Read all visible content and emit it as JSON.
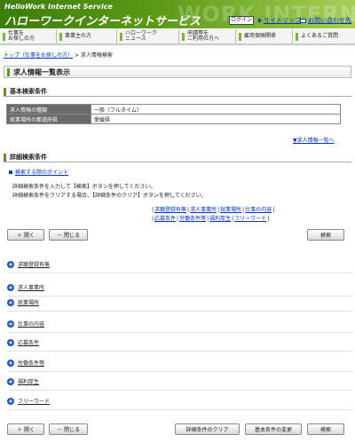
{
  "header": {
    "brand_en": "HelloWork Internet Service",
    "brand_jp": "ハローワークインターネットサービス",
    "watermark": "WORK INTERNE",
    "login": "ログイン",
    "sitemap": "サイトマップ",
    "contact": "お問い合わせ先"
  },
  "nav": [
    {
      "label": "仕事を\nお探しの方"
    },
    {
      "label": "事業主の方"
    },
    {
      "label": "ハローワーク\nニュース"
    },
    {
      "label": "申請等を\nご利用の方へ"
    },
    {
      "label": "雇用保険関係"
    },
    {
      "label": "よくあるご質問"
    }
  ],
  "breadcrumb": {
    "top": "トップ（仕事をお探しの方）",
    "sep": " > ",
    "current": "求人情報検索"
  },
  "title": "求人情報一覧表示",
  "basic": {
    "heading": "基本検索条件",
    "rows": [
      {
        "label": "求人情報の種類",
        "value": "一般（フルタイム）"
      },
      {
        "label": "就業場所の都道府県",
        "value": "愛媛県"
      }
    ],
    "list_link": "▼求人情報一覧へ"
  },
  "detail": {
    "heading": "詳細検索条件",
    "tip": "検索する際のポイント",
    "instr1": "詳細検索条件を入力して【検索】ボタンを押してください。",
    "instr2": "詳細検索条件をクリアする場合、【詳細条件のクリア】ボタンを押してください。",
    "jump_row1": [
      "求職登録有無",
      "求人事業所",
      "就業場所",
      "仕事の内容"
    ],
    "jump_row2": [
      "応募条件",
      "労働条件等",
      "福利厚生",
      "フリーワード"
    ],
    "sections": [
      "求職登録有無",
      "求人事業所",
      "就業場所",
      "仕事の内容",
      "応募条件",
      "労働条件等",
      "福利厚生",
      "フリーワード"
    ]
  },
  "buttons": {
    "open": "＋ 開く",
    "close": "－ 閉じる",
    "search": "検索",
    "clear": "詳細条件のクリア",
    "change": "基本条件の変更"
  },
  "colors": {
    "header_green": "#5c9a16",
    "link": "#0033cc",
    "plus": "#1d56b8"
  }
}
